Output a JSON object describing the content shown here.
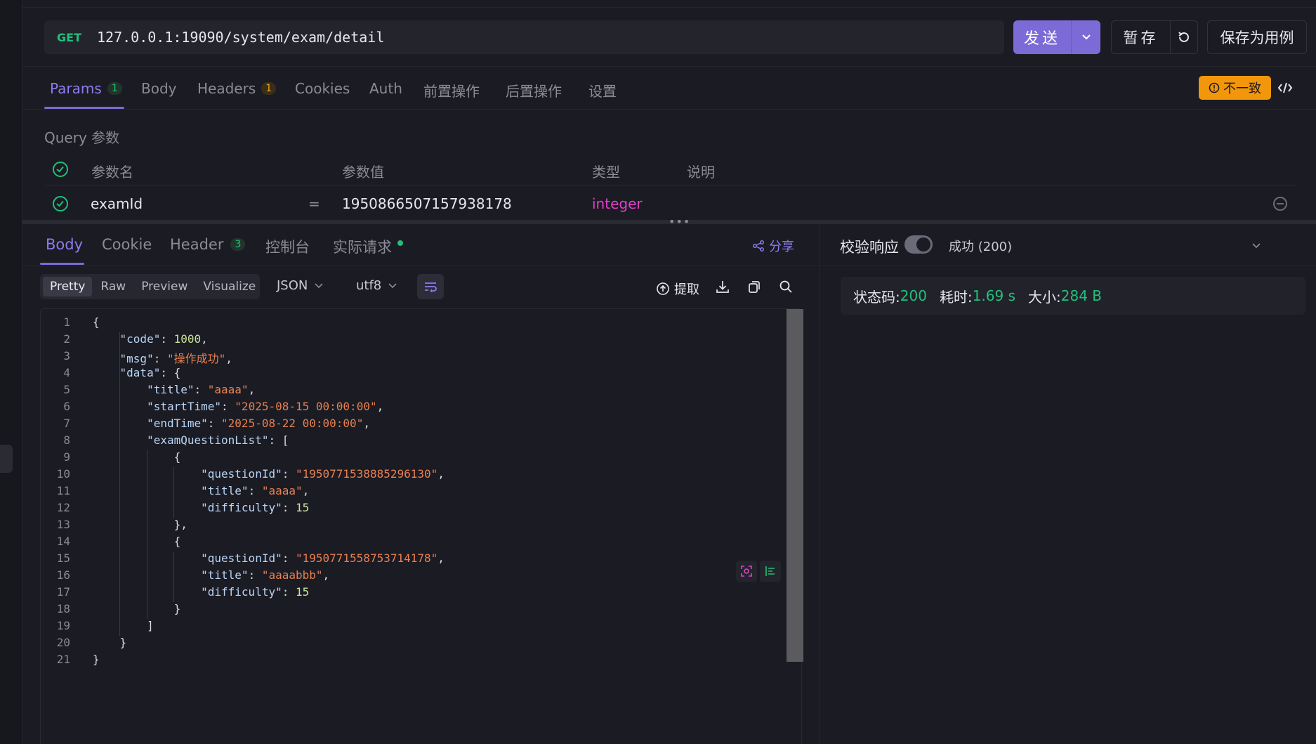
{
  "request": {
    "method": "GET",
    "url": "127.0.0.1:19090/system/exam/detail",
    "send_label": "发送",
    "save_temp_label": "暂存",
    "save_case_label": "保存为用例"
  },
  "request_tabs": [
    {
      "label": "Params",
      "badge": "1"
    },
    {
      "label": "Body"
    },
    {
      "label": "Headers",
      "badge": "1"
    },
    {
      "label": "Cookies"
    },
    {
      "label": "Auth"
    },
    {
      "label": "前置操作"
    },
    {
      "label": "后置操作"
    },
    {
      "label": "设置"
    }
  ],
  "warning_label": "不一致",
  "query": {
    "title": "Query 参数",
    "headers": {
      "name": "参数名",
      "value": "参数值",
      "type": "类型",
      "desc": "说明"
    },
    "rows": [
      {
        "name": "examId",
        "eq": "=",
        "value": "1950866507157938178",
        "type": "integer",
        "desc": ""
      }
    ]
  },
  "response_tabs": [
    {
      "label": "Body"
    },
    {
      "label": "Cookie"
    },
    {
      "label": "Header",
      "badge": "3"
    },
    {
      "label": "控制台"
    },
    {
      "label": "实际请求"
    }
  ],
  "share_label": "分享",
  "view_modes": [
    "Pretty",
    "Raw",
    "Preview",
    "Visualize"
  ],
  "format_select": "JSON",
  "encoding_select": "utf8",
  "extract_label": "提取",
  "code_lines": [
    [
      [
        "p",
        "{"
      ]
    ],
    [
      [
        "p",
        "    "
      ],
      [
        "k",
        "\"code\""
      ],
      [
        "p",
        ": "
      ],
      [
        "n",
        "1000"
      ],
      [
        "p",
        ","
      ]
    ],
    [
      [
        "p",
        "    "
      ],
      [
        "k",
        "\"msg\""
      ],
      [
        "p",
        ": "
      ],
      [
        "s",
        "\"操作成功\""
      ],
      [
        "p",
        ","
      ]
    ],
    [
      [
        "p",
        "    "
      ],
      [
        "k",
        "\"data\""
      ],
      [
        "p",
        ": {"
      ]
    ],
    [
      [
        "p",
        "        "
      ],
      [
        "k",
        "\"title\""
      ],
      [
        "p",
        ": "
      ],
      [
        "s",
        "\"aaaa\""
      ],
      [
        "p",
        ","
      ]
    ],
    [
      [
        "p",
        "        "
      ],
      [
        "k",
        "\"startTime\""
      ],
      [
        "p",
        ": "
      ],
      [
        "s",
        "\"2025-08-15 00:00:00\""
      ],
      [
        "p",
        ","
      ]
    ],
    [
      [
        "p",
        "        "
      ],
      [
        "k",
        "\"endTime\""
      ],
      [
        "p",
        ": "
      ],
      [
        "s",
        "\"2025-08-22 00:00:00\""
      ],
      [
        "p",
        ","
      ]
    ],
    [
      [
        "p",
        "        "
      ],
      [
        "k",
        "\"examQuestionList\""
      ],
      [
        "p",
        ": ["
      ]
    ],
    [
      [
        "p",
        "            {"
      ]
    ],
    [
      [
        "p",
        "                "
      ],
      [
        "k",
        "\"questionId\""
      ],
      [
        "p",
        ": "
      ],
      [
        "s",
        "\"1950771538885296130\""
      ],
      [
        "p",
        ","
      ]
    ],
    [
      [
        "p",
        "                "
      ],
      [
        "k",
        "\"title\""
      ],
      [
        "p",
        ": "
      ],
      [
        "s",
        "\"aaaa\""
      ],
      [
        "p",
        ","
      ]
    ],
    [
      [
        "p",
        "                "
      ],
      [
        "k",
        "\"difficulty\""
      ],
      [
        "p",
        ": "
      ],
      [
        "n",
        "15"
      ]
    ],
    [
      [
        "p",
        "            },"
      ]
    ],
    [
      [
        "p",
        "            {"
      ]
    ],
    [
      [
        "p",
        "                "
      ],
      [
        "k",
        "\"questionId\""
      ],
      [
        "p",
        ": "
      ],
      [
        "s",
        "\"1950771558753714178\""
      ],
      [
        "p",
        ","
      ]
    ],
    [
      [
        "p",
        "                "
      ],
      [
        "k",
        "\"title\""
      ],
      [
        "p",
        ": "
      ],
      [
        "s",
        "\"aaaabbb\""
      ],
      [
        "p",
        ","
      ]
    ],
    [
      [
        "p",
        "                "
      ],
      [
        "k",
        "\"difficulty\""
      ],
      [
        "p",
        ": "
      ],
      [
        "n",
        "15"
      ]
    ],
    [
      [
        "p",
        "            }"
      ]
    ],
    [
      [
        "p",
        "        ]"
      ]
    ],
    [
      [
        "p",
        "    }"
      ]
    ],
    [
      [
        "p",
        "}"
      ]
    ]
  ],
  "validate_label": "校验响应",
  "status_select": "成功 (200)",
  "summary": {
    "status_label": "状态码:",
    "status_value": "200",
    "time_label": "耗时:",
    "time_value": "1.69 s",
    "size_label": "大小:",
    "size_value": "284 B"
  },
  "colors": {
    "accent": "#7c6bd6",
    "success": "#21c07a",
    "warning": "#f2960c",
    "type": "#e041c8",
    "string": "#e88050",
    "number": "#c9e59a",
    "key": "#b8d4f5"
  }
}
